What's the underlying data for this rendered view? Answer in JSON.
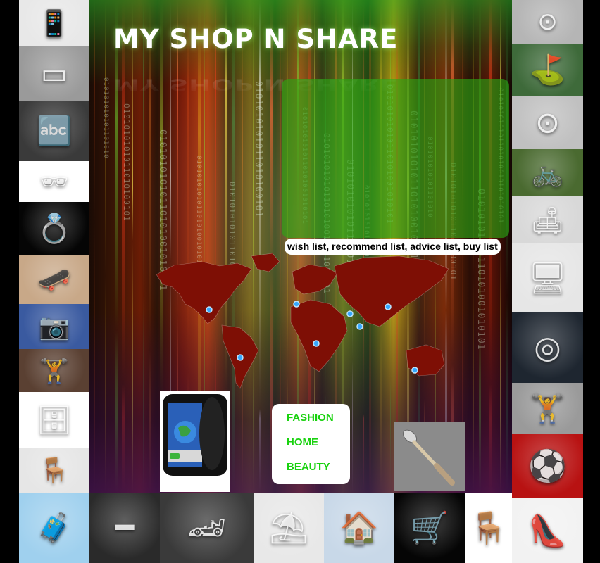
{
  "site": {
    "logo_text": "MY SHOP N SHARE",
    "lists_label": "wish list, recommend list, advice list, buy list",
    "categories": [
      "FASHION",
      "HOME",
      "BEAUTY"
    ],
    "category_color": "#19d20f"
  },
  "tiles": {
    "left": [
      {
        "name": "ipod-dock-tile",
        "icon": "ipod-dock-icon",
        "glyph": "📱",
        "bg": "#e8e8e8"
      },
      {
        "name": "cufflinks-tile",
        "icon": "cufflinks-icon",
        "glyph": "▭",
        "bg": "#9a9a9a"
      },
      {
        "name": "abc-blocks-tile",
        "icon": "abc-blocks-icon",
        "glyph": "🔤",
        "bg": "#3a3a3a"
      },
      {
        "name": "sunglasses-tile",
        "icon": "sunglasses-icon",
        "glyph": "🕶",
        "bg": "#ffffff"
      },
      {
        "name": "ring-tile",
        "icon": "ring-icon",
        "glyph": "💍",
        "bg": "#050505"
      },
      {
        "name": "skateboard-tile",
        "icon": "skateboard-icon",
        "glyph": "🛹",
        "bg": "#c8a888"
      },
      {
        "name": "camera-tile",
        "icon": "camera-icon",
        "glyph": "📷",
        "bg": "#3a5aa0"
      },
      {
        "name": "dumbbell-tile",
        "icon": "dumbbell-icon",
        "glyph": "🏋",
        "bg": "#5a4032"
      },
      {
        "name": "dresser-tile",
        "icon": "dresser-icon",
        "glyph": "🗄",
        "bg": "#ffffff"
      },
      {
        "name": "armchairs-tile",
        "icon": "armchair-icon",
        "glyph": "🪑",
        "bg": "#e6e6e6"
      },
      {
        "name": "suitcase-tile",
        "icon": "suitcase-icon",
        "glyph": "🧳",
        "bg": "#9fd0ee"
      }
    ],
    "right": [
      {
        "name": "wheel-rim-tile",
        "icon": "wheel-rim-icon",
        "glyph": "⊙",
        "bg": "#b5b5b5"
      },
      {
        "name": "golf-ball-tile",
        "icon": "golf-ball-icon",
        "glyph": "⛳",
        "bg": "#3e6a3a"
      },
      {
        "name": "wheel-rim-2-tile",
        "icon": "wheel-rim-icon",
        "glyph": "⊙",
        "bg": "#c0c0c0"
      },
      {
        "name": "tricycle-tile",
        "icon": "tricycle-icon",
        "glyph": "🚲",
        "bg": "#4a6a30"
      },
      {
        "name": "sofa-tile",
        "icon": "sofa-icon",
        "glyph": "🛋",
        "bg": "#d8d8d8"
      },
      {
        "name": "pc-tower-tile",
        "icon": "pc-tower-icon",
        "glyph": "🖥",
        "bg": "#e6e6e6"
      },
      {
        "name": "tires-tile",
        "icon": "tire-icon",
        "glyph": "◎",
        "bg": "#1e2630"
      },
      {
        "name": "dumbbells-tile",
        "icon": "dumbbell-icon",
        "glyph": "🏋",
        "bg": "#9a9a9a"
      },
      {
        "name": "soccer-ball-tile",
        "icon": "soccer-ball-icon",
        "glyph": "⚽",
        "bg": "#b81212"
      },
      {
        "name": "high-heel-tile",
        "icon": "high-heel-icon",
        "glyph": "👠",
        "bg": "#f2f2f2"
      }
    ],
    "bottom": [
      {
        "name": "incense-holder-tile",
        "icon": "incense-holder-icon",
        "glyph": "━",
        "bg": "#2a2a2a"
      },
      {
        "name": "sports-car-tile",
        "icon": "sports-car-icon",
        "glyph": "🏎",
        "bg": "#3a3a3a"
      },
      {
        "name": "patio-set-tile",
        "icon": "patio-set-icon",
        "glyph": "⛱",
        "bg": "#e8e8e8"
      },
      {
        "name": "house-tile",
        "icon": "house-icon",
        "glyph": "🏠",
        "bg": "#c8d8e8"
      },
      {
        "name": "hand-truck-tile",
        "icon": "hand-truck-icon",
        "glyph": "🛒",
        "bg": "#050505"
      },
      {
        "name": "bar-stool-tile",
        "icon": "bar-stool-icon",
        "glyph": "🪑",
        "bg": "#ffffff"
      }
    ]
  },
  "features": {
    "phone_icon": "smartphone-icon",
    "spoon_icon": "spoon-icon"
  }
}
